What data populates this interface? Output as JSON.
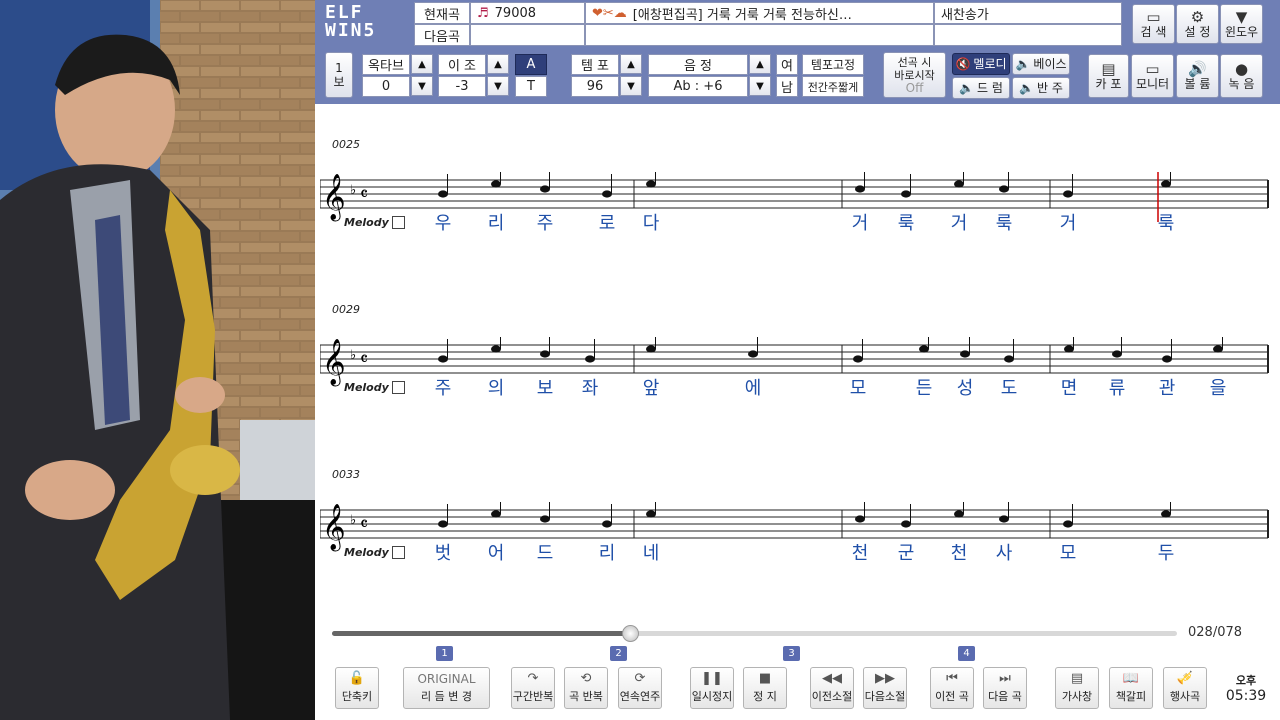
{
  "video": {
    "description_icon": "saxophone-performer-video"
  },
  "toolbar": {
    "logo": "ELF WIN5",
    "current_song_label": "현재곡",
    "next_song_label": "다음곡",
    "song_number": "79008",
    "song_title": "[애창편집곡] 거룩 거룩 거룩 전능하신…",
    "song_category": "새찬송가",
    "search": "검 색",
    "settings": "설 정",
    "window": "윈도우",
    "staff_mode_top": "1",
    "staff_mode_bottom": "보",
    "octave_label": "옥타브",
    "octave_value": "0",
    "transpose_label": "이 조",
    "transpose_value": "-3",
    "a_label": "A",
    "t_label": "T",
    "tempo_label": "템 포",
    "tempo_value": "96",
    "pitch_label": "음 정",
    "pitch_value": "Ab : +6",
    "female": "여",
    "male": "남",
    "tempo_fix": "템포고정",
    "shorten_interlude": "전간주짧게",
    "instant_start_1": "선곡 시",
    "instant_start_2": "바로시작",
    "instant_start_state": "Off",
    "melody": "멜로디",
    "bass": "베이스",
    "drum": "드 럼",
    "accomp": "반 주",
    "capo": "카 포",
    "monitor": "모니터",
    "volume": "볼 륨",
    "record": "녹 음"
  },
  "score": {
    "melody_label": "Melody",
    "rows": [
      {
        "measure": "0025",
        "lyrics": [
          "우",
          "리",
          "주",
          "로",
          "다",
          "거",
          "룩",
          "거",
          "룩",
          "거",
          "룩"
        ]
      },
      {
        "measure": "0029",
        "lyrics": [
          "주",
          "의",
          "보",
          "좌",
          "앞",
          "에",
          "모",
          "든",
          "성",
          "도",
          "면",
          "류",
          "관",
          "을"
        ]
      },
      {
        "measure": "0033",
        "lyrics": [
          "벗",
          "어",
          "드",
          "리",
          "네",
          "천",
          "군",
          "천",
          "사",
          "모",
          "두"
        ]
      }
    ]
  },
  "playback": {
    "progress": 0.353,
    "counter": "028/078",
    "shortcut": "단축키",
    "original": "ORIGINAL",
    "rhythm_change": "리 듬 변 경",
    "section_repeat": "구간반복",
    "song_repeat": "곡 반복",
    "continuous": "연속연주",
    "pause": "일시정지",
    "stop": "정 지",
    "prev_measure": "이전소절",
    "next_measure": "다음소절",
    "prev_song": "이전 곡",
    "next_song": "다음 곡",
    "lyrics_window": "가사창",
    "bookmark": "책갈피",
    "march": "행사곡",
    "ampm": "오후",
    "time": "05:39",
    "badges": [
      "1",
      "2",
      "3",
      "4"
    ]
  },
  "colors": {
    "toolbar": "#6f7fb5",
    "lyrics": "#1f4fa8",
    "playhead": "#cc0000"
  }
}
